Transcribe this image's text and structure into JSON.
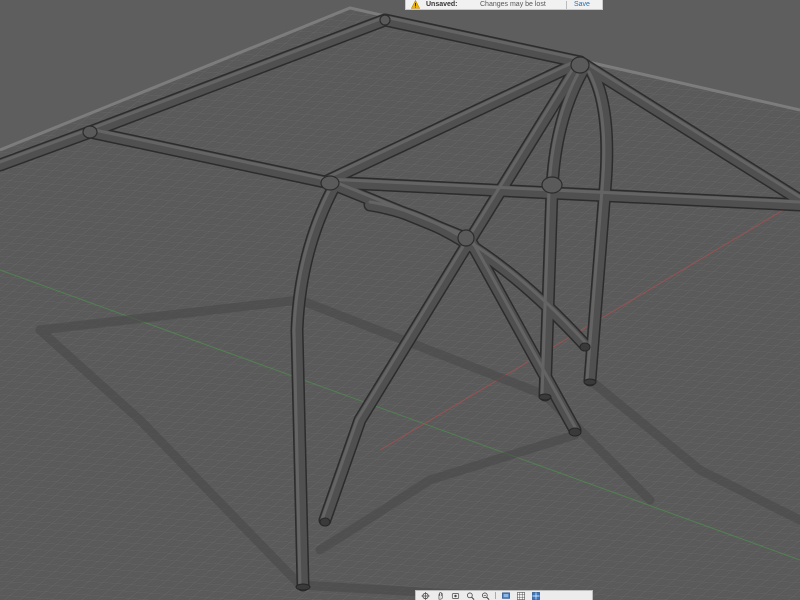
{
  "banner": {
    "status": "Unsaved:",
    "message": "Changes may be lost",
    "action": "Save",
    "warning_icon": "warning-icon"
  },
  "viewport": {
    "content": "roll-cage-3d-model",
    "background": "#5c5c5c",
    "grid_color": "#6f6f6f",
    "tube_color": "#4a4a4a",
    "x_axis_color": "#a04a4a",
    "y_axis_color": "#4a8a4a"
  },
  "navbar": {
    "tools": [
      "orbit-icon",
      "pan-icon",
      "look-at-icon",
      "zoom-icon",
      "fit-icon",
      "display-settings-icon",
      "grid-settings-icon",
      "viewports-icon"
    ]
  }
}
